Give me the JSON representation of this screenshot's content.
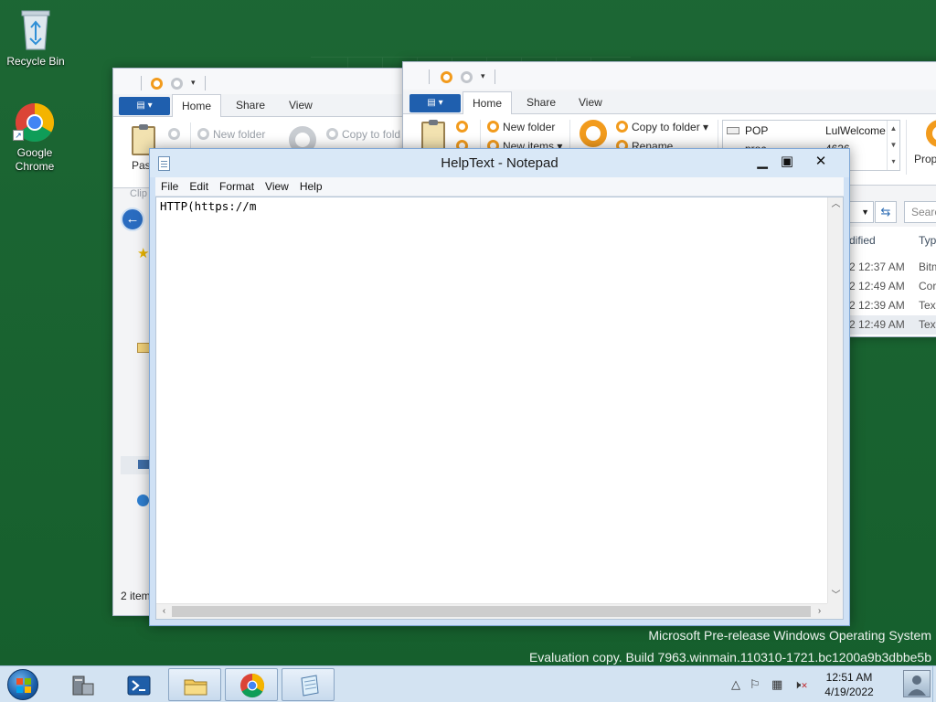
{
  "desktop": {
    "icons": [
      {
        "label": "Recycle Bin"
      },
      {
        "label": "Google Chrome"
      }
    ]
  },
  "explorer_back": {
    "tabs": [
      "Home",
      "Share",
      "View"
    ],
    "ribbon": {
      "new_folder": "New folder",
      "copy_to": "Copy to fold",
      "paste": "Past",
      "clipboard": "Clip"
    },
    "status": "2 item"
  },
  "explorer_front": {
    "tabs": [
      "Home",
      "Share",
      "View"
    ],
    "ribbon": {
      "new_folder": "New folder",
      "new_items": "New items",
      "copy_to_folder": "Copy to folder",
      "rename": "Rename",
      "properties": "Prop"
    },
    "dropdown_list": [
      {
        "name": "POP",
        "value": "LulWelcome"
      },
      {
        "name": "proc",
        "value": "4636"
      }
    ],
    "search_placeholder": "Search",
    "columns": {
      "modified": "dified",
      "type": "Typ"
    },
    "rows": [
      {
        "modified": "2 12:37 AM",
        "type": "Bitm"
      },
      {
        "modified": "2 12:49 AM",
        "type": "Cor"
      },
      {
        "modified": "2 12:39 AM",
        "type": "Text"
      },
      {
        "modified": "2 12:49 AM",
        "type": "Text"
      }
    ]
  },
  "notepad": {
    "title": "HelpText - Notepad",
    "menu": [
      "File",
      "Edit",
      "Format",
      "View",
      "Help"
    ],
    "content": "HTTP(https://m"
  },
  "watermark": {
    "line1": "Microsoft Pre-release Windows Operating System",
    "line2": "Evaluation copy. Build 7963.winmain.110310-1721.bc1200a9b3dbbe5b"
  },
  "taskbar": {
    "time": "12:51 AM",
    "date": "4/19/2022",
    "pinned": [
      "server-manager-icon",
      "powershell-icon",
      "file-explorer-icon",
      "chrome-icon",
      "notepad-icon"
    ]
  }
}
